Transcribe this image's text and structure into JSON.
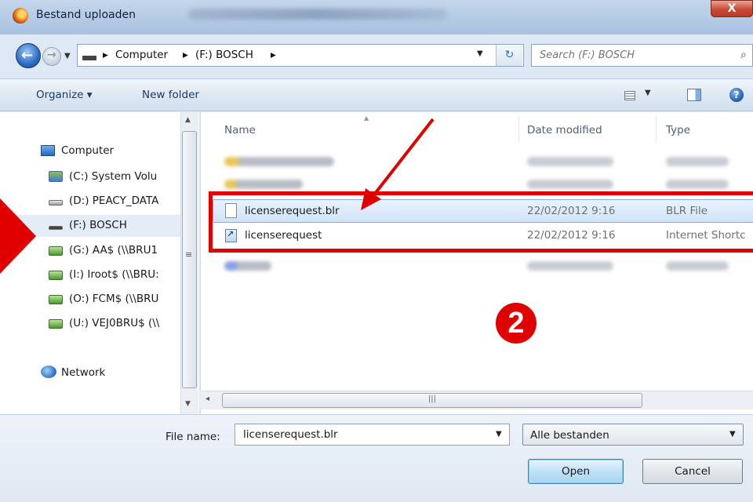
{
  "window": {
    "title": "Bestand uploaden",
    "close_label": "X"
  },
  "address": {
    "crumbs": [
      "Computer",
      "(F:) BOSCH"
    ],
    "search_placeholder": "Search (F:) BOSCH"
  },
  "toolbar": {
    "organize_label": "Organize ▾",
    "new_folder_label": "New folder"
  },
  "nav": {
    "computer": "Computer",
    "drives": [
      "(C:) System Volu",
      "(D:) PEACY_DATA",
      "(F:) BOSCH",
      "(G:) AA$ (\\\\BRU1",
      "(I:) Iroot$ (\\\\BRU:",
      "(O:) FCM$ (\\\\BRU",
      "(U:) VEJ0BRU$ (\\\\"
    ],
    "network": "Network"
  },
  "columns": {
    "name": "Name",
    "date": "Date modified",
    "type": "Type"
  },
  "files": [
    {
      "name": "licenserequest.blr",
      "date": "22/02/2012 9:16",
      "type": "BLR File"
    },
    {
      "name": "licenserequest",
      "date": "22/02/2012 9:16",
      "type": "Internet Shortc"
    }
  ],
  "hscroll_grip": "|||",
  "bottom": {
    "filename_label": "File name:",
    "filename_value": "licenserequest.blr",
    "filetype_value": "Alle bestanden",
    "open_label": "Open",
    "cancel_label": "Cancel"
  },
  "annotation": {
    "step_number": "2"
  },
  "colors": {
    "annotation_red": "#e00000",
    "selection_blue": "#cfe4fa"
  }
}
